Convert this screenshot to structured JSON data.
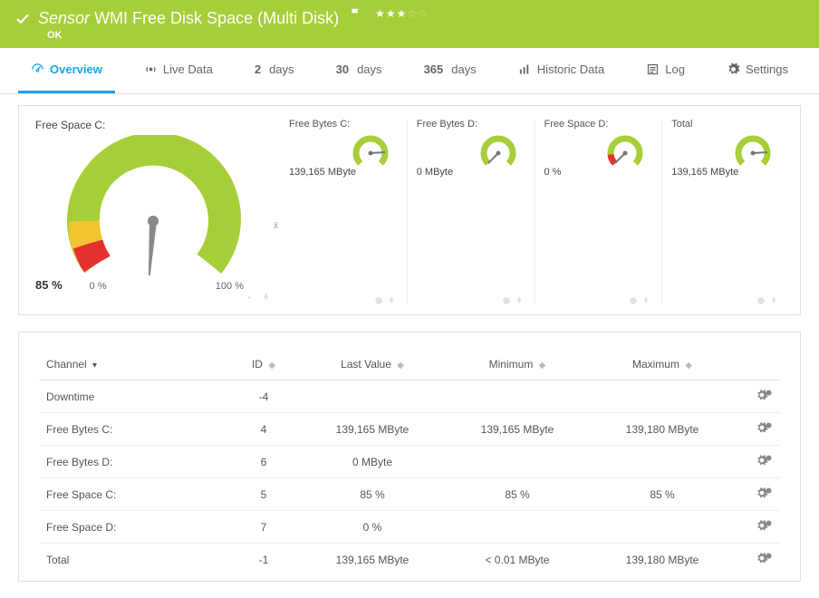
{
  "header": {
    "prefix": "Sensor",
    "title": "WMI Free Disk Space (Multi Disk)",
    "status": "OK",
    "rating": 3
  },
  "tabs": {
    "overview": "Overview",
    "live": "Live Data",
    "d2_num": "2",
    "d2_unit": "days",
    "d30_num": "30",
    "d30_unit": "days",
    "d365_num": "365",
    "d365_unit": "days",
    "historic": "Historic Data",
    "log": "Log",
    "settings": "Settings"
  },
  "mainGauge": {
    "label": "Free Space C:",
    "value": "85 %",
    "rangeMin": "0 %",
    "rangeMax": "100 %"
  },
  "miniGauges": [
    {
      "label": "Free Bytes C:",
      "value": "139,165 MByte",
      "pct": 82,
      "type": "green"
    },
    {
      "label": "Free Bytes D:",
      "value": "0 MByte",
      "pct": 0,
      "type": "green"
    },
    {
      "label": "Free Space D:",
      "value": "0 %",
      "pct": 0,
      "type": "red"
    },
    {
      "label": "Total",
      "value": "139,165 MByte",
      "pct": 82,
      "type": "green"
    }
  ],
  "tableHeaders": {
    "channel": "Channel",
    "id": "ID",
    "last": "Last Value",
    "min": "Minimum",
    "max": "Maximum"
  },
  "rows": [
    {
      "channel": "Downtime",
      "id": "-4",
      "last": "",
      "min": "",
      "max": ""
    },
    {
      "channel": "Free Bytes C:",
      "id": "4",
      "last": "139,165 MByte",
      "min": "139,165 MByte",
      "max": "139,180 MByte"
    },
    {
      "channel": "Free Bytes D:",
      "id": "6",
      "last": "0 MByte",
      "min": "",
      "max": ""
    },
    {
      "channel": "Free Space C:",
      "id": "5",
      "last": "85 %",
      "min": "85 %",
      "max": "85 %"
    },
    {
      "channel": "Free Space D:",
      "id": "7",
      "last": "0 %",
      "min": "",
      "max": ""
    },
    {
      "channel": "Total",
      "id": "-1",
      "last": "139,165 MByte",
      "min": "< 0.01 MByte",
      "max": "139,180 MByte"
    }
  ],
  "chart_data": {
    "type": "bar",
    "title": "Free Space C:",
    "categories": [
      "Free Space C:"
    ],
    "values": [
      85
    ],
    "ylim": [
      0,
      100
    ],
    "ylabel": "%",
    "series": [
      {
        "name": "Free Bytes C:",
        "value": 139165,
        "unit": "MByte"
      },
      {
        "name": "Free Bytes D:",
        "value": 0,
        "unit": "MByte"
      },
      {
        "name": "Free Space D:",
        "value": 0,
        "unit": "%"
      },
      {
        "name": "Total",
        "value": 139165,
        "unit": "MByte"
      }
    ]
  }
}
